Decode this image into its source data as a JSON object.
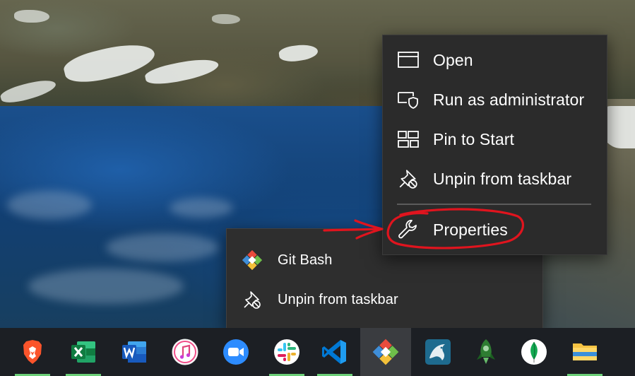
{
  "context_menu": {
    "items": [
      {
        "label": "Open",
        "icon": "window-icon"
      },
      {
        "label": "Run as administrator",
        "icon": "shield-icon"
      },
      {
        "label": "Pin to Start",
        "icon": "pin-to-start-icon"
      },
      {
        "label": "Unpin from taskbar",
        "icon": "unpin-icon"
      },
      {
        "label": "Properties",
        "icon": "wrench-icon"
      }
    ]
  },
  "jump_list": {
    "items": [
      {
        "label": "Git Bash",
        "icon": "git-icon"
      },
      {
        "label": "Unpin from taskbar",
        "icon": "unpin-icon"
      }
    ]
  },
  "annotation": {
    "color": "#e0141e"
  },
  "taskbar": {
    "apps": [
      {
        "name": "Brave",
        "icon": "brave-icon",
        "running": true
      },
      {
        "name": "Excel",
        "icon": "excel-icon",
        "running": true
      },
      {
        "name": "Word",
        "icon": "word-icon",
        "running": false
      },
      {
        "name": "iTunes",
        "icon": "itunes-icon",
        "running": false
      },
      {
        "name": "Zoom",
        "icon": "zoom-icon",
        "running": false
      },
      {
        "name": "Slack",
        "icon": "slack-icon",
        "running": true
      },
      {
        "name": "Visual Studio Code",
        "icon": "vscode-icon",
        "running": true
      },
      {
        "name": "Git Bash",
        "icon": "git-icon",
        "running": false,
        "active": true
      },
      {
        "name": "MySQL Workbench",
        "icon": "mysql-icon",
        "running": false
      },
      {
        "name": "Robo 3T",
        "icon": "robo3t-icon",
        "running": false
      },
      {
        "name": "MongoDB Compass",
        "icon": "mongodb-icon",
        "running": false
      },
      {
        "name": "File Explorer",
        "icon": "folder-icon",
        "running": true
      }
    ],
    "indicator_color": "#6ccf78"
  }
}
